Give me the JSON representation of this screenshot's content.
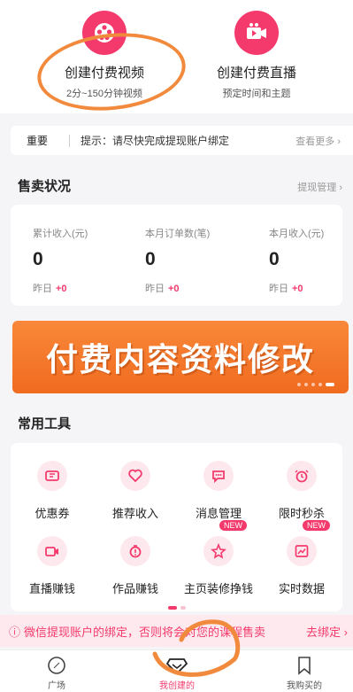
{
  "create": {
    "video": {
      "title": "创建付费视频",
      "subtitle": "2分~150分钟视频"
    },
    "live": {
      "title": "创建付费直播",
      "subtitle": "预定时间和主题"
    }
  },
  "notice": {
    "tag": "重要",
    "text": "提示：请尽快完成提现账户绑定",
    "more": "查看更多 ›"
  },
  "sales": {
    "title": "售卖状况",
    "link": "提现管理 ›",
    "stats": [
      {
        "label": "累计收入(元)",
        "value": "0",
        "yesterday_label": "昨日",
        "yesterday_value": "+0"
      },
      {
        "label": "本月订单数(笔)",
        "value": "0",
        "yesterday_label": "昨日",
        "yesterday_value": "+0"
      },
      {
        "label": "本月收入(元)",
        "value": "0",
        "yesterday_label": "昨日",
        "yesterday_value": "+0"
      }
    ]
  },
  "banner": {
    "text": "付费内容资料修改"
  },
  "tools": {
    "title": "常用工具",
    "items": [
      {
        "label": "优惠券",
        "icon": "coupon-icon"
      },
      {
        "label": "推荐收入",
        "icon": "heart-tag-icon"
      },
      {
        "label": "消息管理",
        "icon": "message-icon"
      },
      {
        "label": "限时秒杀",
        "icon": "alarm-icon"
      },
      {
        "label": "直播赚钱",
        "icon": "camera-icon"
      },
      {
        "label": "作品赚钱",
        "icon": "money-bag-icon"
      },
      {
        "label": "主页装修挣钱",
        "icon": "star-brush-icon",
        "badge": "NEW"
      },
      {
        "label": "实时数据",
        "icon": "chart-icon",
        "badge": "NEW"
      }
    ]
  },
  "warning": {
    "icon": "ⓘ",
    "text": "微信提现账户的绑定，否则将会对您的课程售卖",
    "action": "去绑定 ›"
  },
  "tabs": [
    {
      "label": "广场",
      "icon": "compass-icon"
    },
    {
      "label": "我创建的",
      "icon": "diamond-icon"
    },
    {
      "label": "我购买的",
      "icon": "bookmark-icon"
    }
  ],
  "colors": {
    "accent": "#f43a6c",
    "banner": "#f06b1f",
    "annotation": "#f28a3d"
  }
}
